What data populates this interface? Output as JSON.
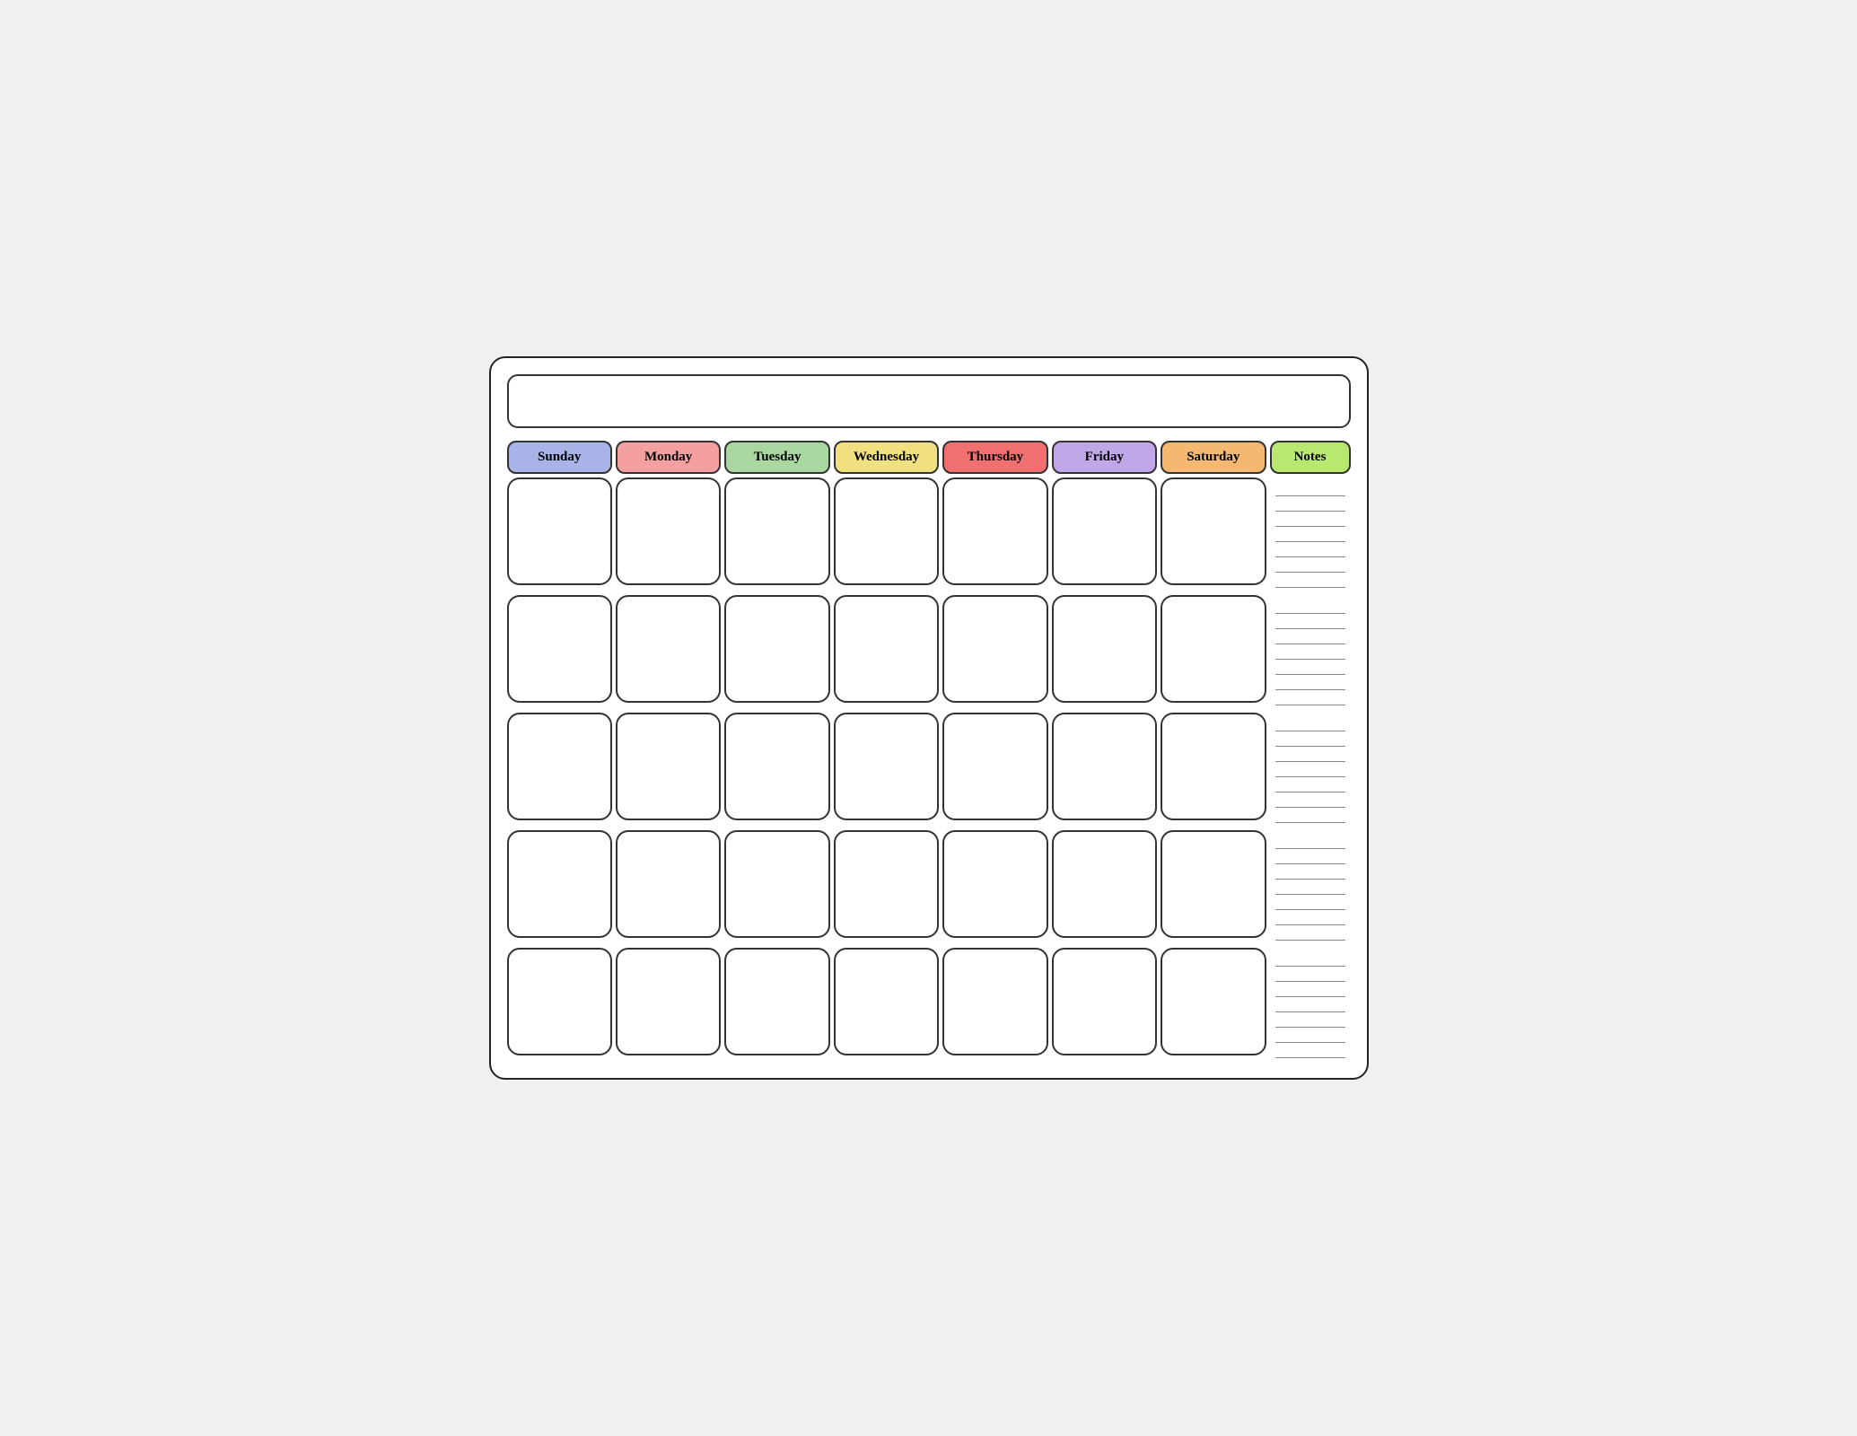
{
  "header": {
    "title": ""
  },
  "days": {
    "headers": [
      "Sunday",
      "Monday",
      "Tuesday",
      "Wednesday",
      "Thursday",
      "Friday",
      "Saturday",
      "Notes"
    ],
    "headerClasses": [
      "header-sunday",
      "header-monday",
      "header-tuesday",
      "header-wednesday",
      "header-thursday",
      "header-friday",
      "header-saturday",
      "header-notes"
    ],
    "weeks": 5,
    "noteLinesPerRow": 7
  }
}
